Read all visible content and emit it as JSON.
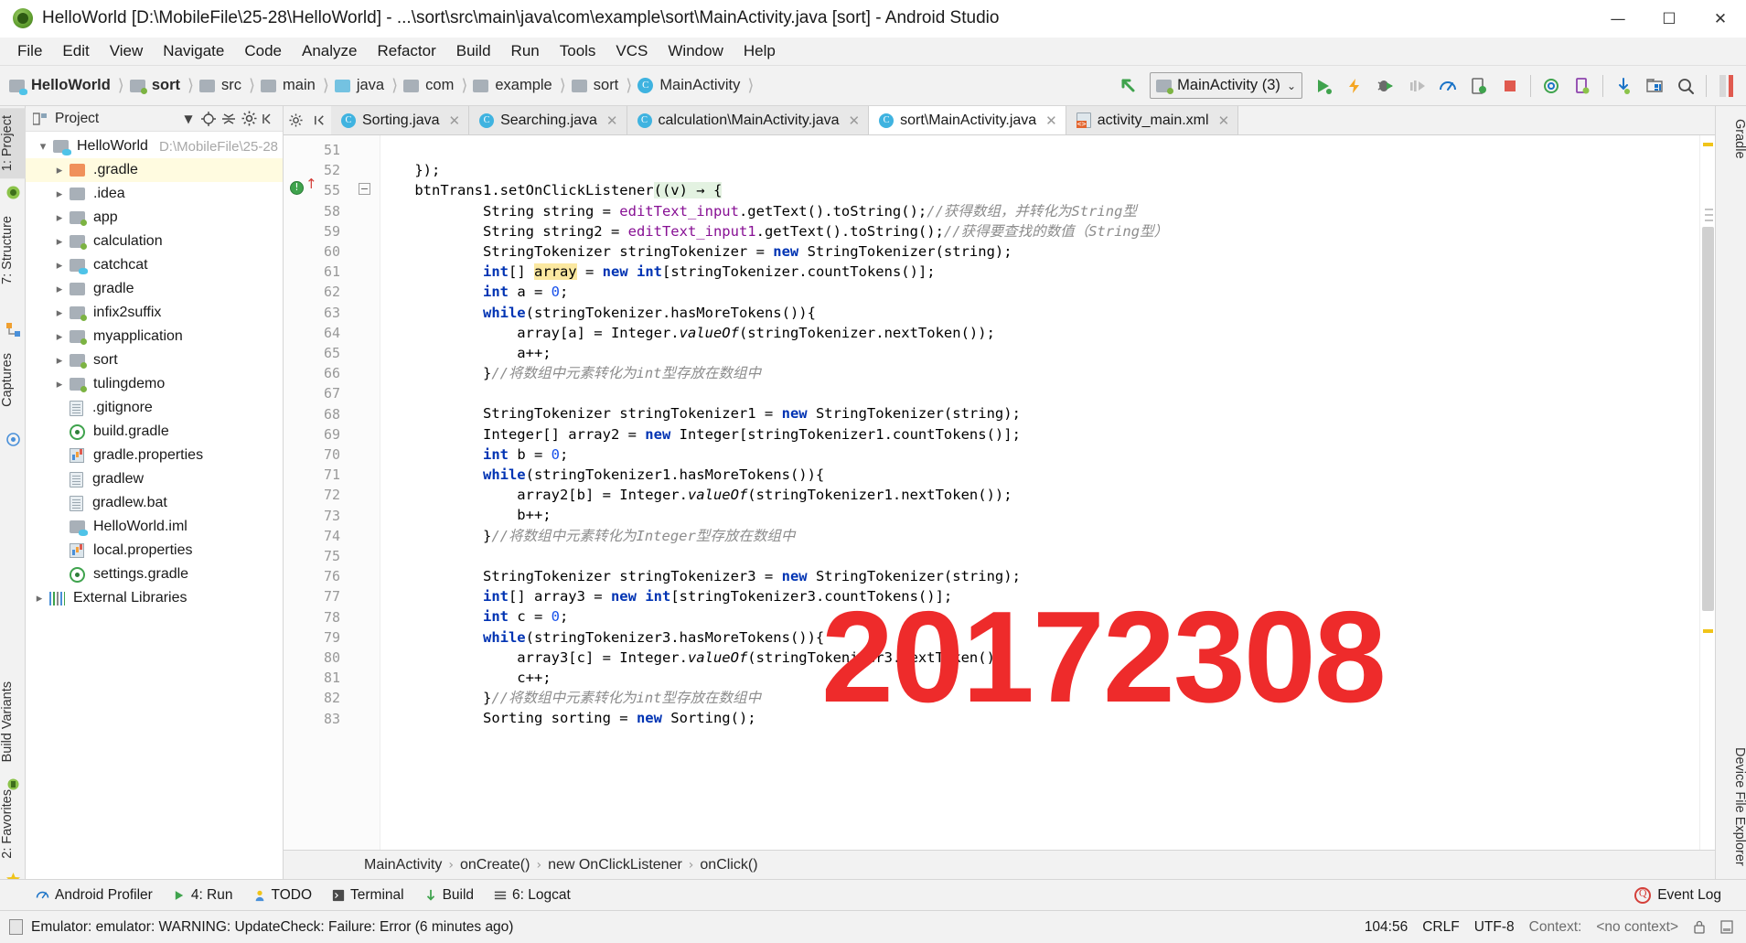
{
  "window": {
    "title": "HelloWorld [D:\\MobileFile\\25-28\\HelloWorld] - ...\\sort\\src\\main\\java\\com\\example\\sort\\MainActivity.java [sort] - Android Studio",
    "app_icon": "android-studio-icon",
    "minimize": "—",
    "maximize": "☐",
    "close": "✕"
  },
  "menu": {
    "items": [
      "File",
      "Edit",
      "View",
      "Navigate",
      "Code",
      "Analyze",
      "Refactor",
      "Build",
      "Run",
      "Tools",
      "VCS",
      "Window",
      "Help"
    ]
  },
  "breadcrumb_top": {
    "items": [
      {
        "label": "HelloWorld",
        "icon": "project-folder-icon",
        "bold": true
      },
      {
        "label": "sort",
        "icon": "module-folder-icon",
        "bold": true
      },
      {
        "label": "src",
        "icon": "folder-icon",
        "bold": false
      },
      {
        "label": "main",
        "icon": "folder-icon",
        "bold": false
      },
      {
        "label": "java",
        "icon": "java-source-folder-icon",
        "bold": false
      },
      {
        "label": "com",
        "icon": "package-folder-icon",
        "bold": false
      },
      {
        "label": "example",
        "icon": "package-folder-icon",
        "bold": false
      },
      {
        "label": "sort",
        "icon": "package-folder-icon",
        "bold": false
      },
      {
        "label": "MainActivity",
        "icon": "java-class-icon",
        "bold": false
      }
    ]
  },
  "toolbar": {
    "back_icon": "back-arrow-icon",
    "run_config": "MainActivity (3)",
    "run_config_icon": "android-config-icon",
    "caret": "⌄",
    "buttons": [
      "run-icon",
      "apply-changes-icon",
      "debug-icon",
      "apply-code-changes-icon",
      "profiler-icon",
      "attach-debugger-icon",
      "stop-icon",
      "sync-gradle-icon",
      "avd-manager-icon",
      "sdk-manager-icon",
      "layout-inspector-icon",
      "search-everywhere-icon"
    ]
  },
  "project_panel": {
    "header": "Project",
    "header_icons": [
      "chevron-down-icon",
      "locate-icon",
      "collapse-all-icon",
      "gear-icon",
      "hide-icon"
    ],
    "root": {
      "label": "HelloWorld",
      "path": "D:\\MobileFile\\25-28",
      "icon": "project-folder-icon"
    },
    "items": [
      {
        "label": ".gradle",
        "icon": "folder-orange-icon",
        "expandable": true,
        "highlighted": true
      },
      {
        "label": ".idea",
        "icon": "folder-icon",
        "expandable": true,
        "highlighted": false
      },
      {
        "label": "app",
        "icon": "module-folder-icon",
        "expandable": true,
        "highlighted": false
      },
      {
        "label": "calculation",
        "icon": "module-folder-icon",
        "expandable": true,
        "highlighted": false
      },
      {
        "label": "catchcat",
        "icon": "java-module-icon",
        "expandable": true,
        "highlighted": false
      },
      {
        "label": "gradle",
        "icon": "folder-icon",
        "expandable": true,
        "highlighted": false
      },
      {
        "label": "infix2suffix",
        "icon": "module-folder-icon",
        "expandable": true,
        "highlighted": false
      },
      {
        "label": "myapplication",
        "icon": "module-folder-icon",
        "expandable": true,
        "highlighted": false
      },
      {
        "label": "sort",
        "icon": "module-folder-icon",
        "expandable": true,
        "highlighted": false
      },
      {
        "label": "tulingdemo",
        "icon": "module-folder-icon",
        "expandable": true,
        "highlighted": false
      },
      {
        "label": ".gitignore",
        "icon": "text-file-icon",
        "expandable": false,
        "highlighted": false
      },
      {
        "label": "build.gradle",
        "icon": "gradle-file-icon",
        "expandable": false,
        "highlighted": false
      },
      {
        "label": "gradle.properties",
        "icon": "properties-file-icon",
        "expandable": false,
        "highlighted": false
      },
      {
        "label": "gradlew",
        "icon": "text-file-icon",
        "expandable": false,
        "highlighted": false
      },
      {
        "label": "gradlew.bat",
        "icon": "text-file-icon",
        "expandable": false,
        "highlighted": false
      },
      {
        "label": "HelloWorld.iml",
        "icon": "java-module-icon",
        "expandable": false,
        "highlighted": false
      },
      {
        "label": "local.properties",
        "icon": "properties-file-icon",
        "expandable": false,
        "highlighted": false
      },
      {
        "label": "settings.gradle",
        "icon": "gradle-file-icon",
        "expandable": false,
        "highlighted": false
      }
    ],
    "external_libraries": {
      "label": "External Libraries",
      "icon": "libraries-icon"
    }
  },
  "left_strip": {
    "tabs": [
      "1: Project",
      "7: Structure",
      "Captures",
      "Build Variants",
      "2: Favorites"
    ],
    "icons": [
      "android-icon",
      "structure-icon",
      "captures-icon",
      "build-variants-icon",
      "favorites-star-icon"
    ]
  },
  "right_strip": {
    "tabs": [
      "Gradle",
      "Device File Explorer"
    ]
  },
  "editor_tabs": [
    {
      "label": "Sorting.java",
      "icon": "java-class-runnable-icon",
      "active": false,
      "close": "✕"
    },
    {
      "label": "Searching.java",
      "icon": "java-class-icon",
      "active": false,
      "close": "✕"
    },
    {
      "label": "calculation\\MainActivity.java",
      "icon": "java-class-icon",
      "active": false,
      "close": "✕"
    },
    {
      "label": "sort\\MainActivity.java",
      "icon": "java-class-icon",
      "active": true,
      "close": "✕"
    },
    {
      "label": "activity_main.xml",
      "icon": "android-xml-icon",
      "active": false,
      "close": "✕"
    }
  ],
  "editor": {
    "line_numbers": [
      "51",
      "52",
      "55",
      "58",
      "59",
      "60",
      "61",
      "62",
      "63",
      "64",
      "65",
      "66",
      "67",
      "68",
      "69",
      "70",
      "71",
      "72",
      "73",
      "74",
      "75",
      "76",
      "77",
      "78",
      "79",
      "80",
      "81",
      "82",
      "83"
    ],
    "gutter_markers": {
      "breakpoint_line": "55",
      "fold_line": "55",
      "fold_glyph": "−"
    },
    "lines": [
      "",
      "    });",
      "    btnTrans1.setOnClickListener((v) → {",
      "            String string = editText_input.getText().toString();//获得数组，并转化为String型",
      "            String string2 = editText_input1.getText().toString();//获得要查找的数值（String型）",
      "            StringTokenizer stringTokenizer = new StringTokenizer(string);",
      "            int[] array = new int[stringTokenizer.countTokens()];",
      "            int a = 0;",
      "            while(stringTokenizer.hasMoreTokens()){",
      "                array[a] = Integer.valueOf(stringTokenizer.nextToken());",
      "                a++;",
      "            }//将数组中元素转化为int型存放在数组中",
      "",
      "            StringTokenizer stringTokenizer1 = new StringTokenizer(string);",
      "            Integer[] array2 = new Integer[stringTokenizer1.countTokens()];",
      "            int b = 0;",
      "            while(stringTokenizer1.hasMoreTokens()){",
      "                array2[b] = Integer.valueOf(stringTokenizer1.nextToken());",
      "                b++;",
      "            }//将数组中元素转化为Integer型存放在数组中",
      "",
      "            StringTokenizer stringTokenizer3 = new StringTokenizer(string);",
      "            int[] array3 = new int[stringTokenizer3.countTokens()];",
      "            int c = 0;",
      "            while(stringTokenizer3.hasMoreTokens()){",
      "                array3[c] = Integer.valueOf(stringTokenizer3.nextToken());",
      "                c++;",
      "            }//将数组中元素转化为int型存放在数组中",
      "            Sorting sorting = new Sorting();"
    ],
    "highlighted_identifier": "array",
    "watermark": "20172308"
  },
  "editor_breadcrumb": {
    "items": [
      "MainActivity",
      "onCreate()",
      "new OnClickListener",
      "onClick()"
    ],
    "separator": "›"
  },
  "bottom_bar": {
    "items": [
      {
        "label": "Android Profiler",
        "icon": "profiler-icon"
      },
      {
        "label": "4: Run",
        "icon": "run-icon"
      },
      {
        "label": "TODO",
        "icon": "todo-icon"
      },
      {
        "label": "Terminal",
        "icon": "terminal-icon"
      },
      {
        "label": "Build",
        "icon": "build-icon"
      },
      {
        "label": "6: Logcat",
        "icon": "logcat-icon"
      }
    ],
    "event_log": {
      "label": "Event Log",
      "icon": "event-log-icon"
    }
  },
  "status_bar": {
    "message": "Emulator: emulator: WARNING: UpdateCheck: Failure: Error (6 minutes ago)",
    "position": "104:56",
    "line_separator": "CRLF",
    "encoding": "UTF-8",
    "context_label": "Context:",
    "context_value": "<no context>",
    "icons": [
      "lock-icon",
      "memory-icon"
    ]
  },
  "colors": {
    "accent_blue": "#3fb3e0",
    "keyword": "#0033b3",
    "number": "#1750eb",
    "field": "#871094",
    "comment": "#8c8c8c",
    "watermark_red": "#ee2b2b",
    "highlight_yellow": "#fbe8a0",
    "tree_highlight": "#fffbe0"
  }
}
